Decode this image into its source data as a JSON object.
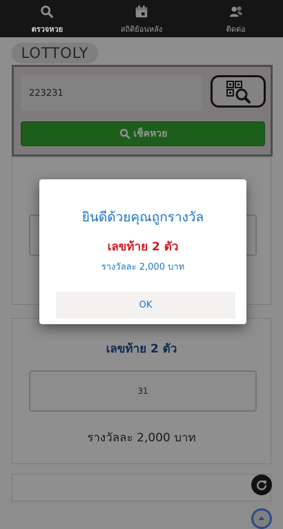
{
  "nav": {
    "items": [
      {
        "label": "ตรวจหวย",
        "icon": "search-icon"
      },
      {
        "label": "สถิติย้อนหลัง",
        "icon": "calendar-icon"
      },
      {
        "label": "ติดต่อ",
        "icon": "contact-icon"
      }
    ]
  },
  "app": {
    "logo": "LOTTOLY"
  },
  "search": {
    "value": "223231",
    "check_label": "เช็คหวย"
  },
  "cards": [
    {
      "title": "เลขท้าย 2 ตัว",
      "number": "31",
      "prize": "รางวัลละ 2,000 บาท"
    }
  ],
  "dialog": {
    "title": "ยินดีด้วยคุณถูกรางวัล",
    "result": "เลขท้าย 2 ตัว",
    "prize": "รางวัลละ 2,000 บาท",
    "ok_label": "OK"
  },
  "colors": {
    "accent": "#1b73c8",
    "result": "#d81b22",
    "check_button": "#2e8b2c",
    "nav_bg": "#151515"
  }
}
